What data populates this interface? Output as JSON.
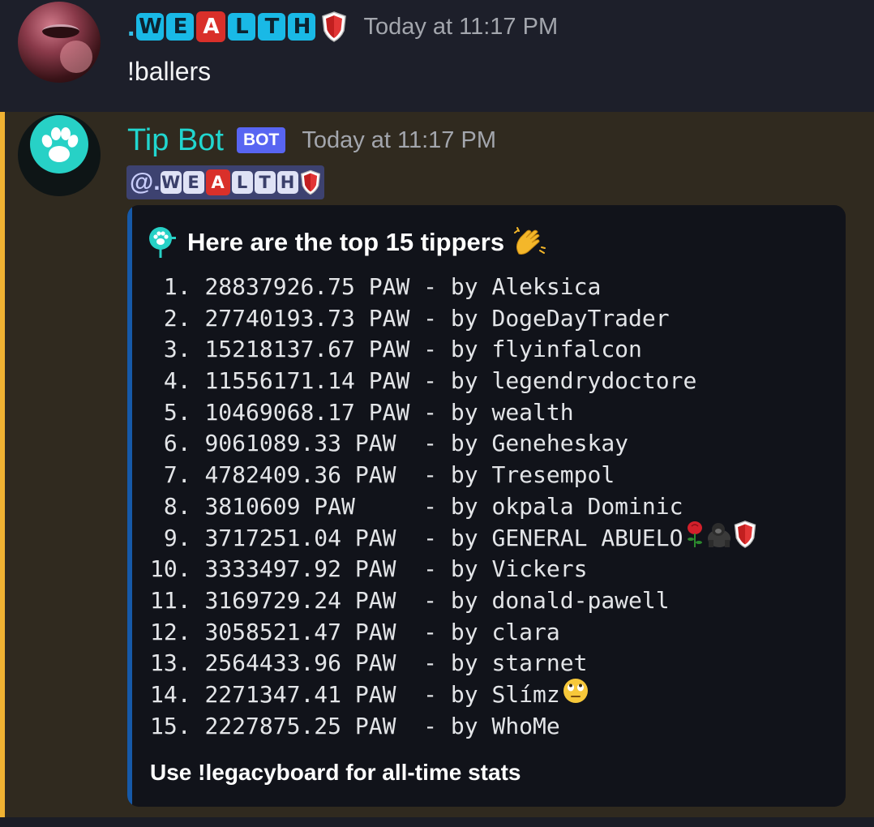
{
  "message1": {
    "author_prefix": ".",
    "author_letters": [
      "W",
      "E",
      "A",
      "L",
      "T",
      "H"
    ],
    "author_red_letter_index": 2,
    "author_suffix_icon": "shield-icon",
    "timestamp": "Today at 11:17 PM",
    "content": "!ballers"
  },
  "message2": {
    "author": "Tip Bot",
    "badge": "BOT",
    "timestamp": "Today at 11:17 PM",
    "mention_prefix": "@.",
    "mention_letters": [
      "W",
      "E",
      "A",
      "L",
      "T",
      "H"
    ],
    "embed": {
      "title": "Here are the top 15 tippers",
      "title_icon": "paw-icon",
      "title_emoji": "clapping-hands-icon",
      "rows": [
        {
          "rank": " 1.",
          "amount": "28837926.75 PAW",
          "name": "Aleksica"
        },
        {
          "rank": " 2.",
          "amount": "27740193.73 PAW",
          "name": "DogeDayTrader"
        },
        {
          "rank": " 3.",
          "amount": "15218137.67 PAW",
          "name": "flyinfalcon"
        },
        {
          "rank": " 4.",
          "amount": "11556171.14 PAW",
          "name": "legendrydoctore"
        },
        {
          "rank": " 5.",
          "amount": "10469068.17 PAW",
          "name": "wealth"
        },
        {
          "rank": " 6.",
          "amount": "9061089.33 PAW ",
          "name": "Geneheskay"
        },
        {
          "rank": " 7.",
          "amount": "4782409.36 PAW ",
          "name": "Tresempol"
        },
        {
          "rank": " 8.",
          "amount": "3810609 PAW    ",
          "name": "okpala Dominic"
        },
        {
          "rank": " 9.",
          "amount": "3717251.04 PAW ",
          "name": "GENERAL ABUELO",
          "emojis": [
            "rose-icon",
            "gorilla-icon",
            "shield-icon"
          ]
        },
        {
          "rank": "10.",
          "amount": "3333497.92 PAW ",
          "name": "Vickers"
        },
        {
          "rank": "11.",
          "amount": "3169729.24 PAW ",
          "name": "donald-pawell"
        },
        {
          "rank": "12.",
          "amount": "3058521.47 PAW ",
          "name": "clara"
        },
        {
          "rank": "13.",
          "amount": "2564433.96 PAW ",
          "name": "starnet"
        },
        {
          "rank": "14.",
          "amount": "2271347.41 PAW ",
          "name": "Slímz",
          "emojis": [
            "eye-roll-face-icon"
          ]
        },
        {
          "rank": "15.",
          "amount": "2227875.25 PAW ",
          "name": "WhoMe"
        }
      ],
      "separator": " - by ",
      "footer": "Use !legacyboard for all-time stats"
    }
  },
  "colors": {
    "bot_name": "#21d6cf",
    "badge": "#5865f2",
    "mention_bg": "#3d4270",
    "embed_bar": "#1659a8",
    "highlight_bar": "#f0b232"
  }
}
